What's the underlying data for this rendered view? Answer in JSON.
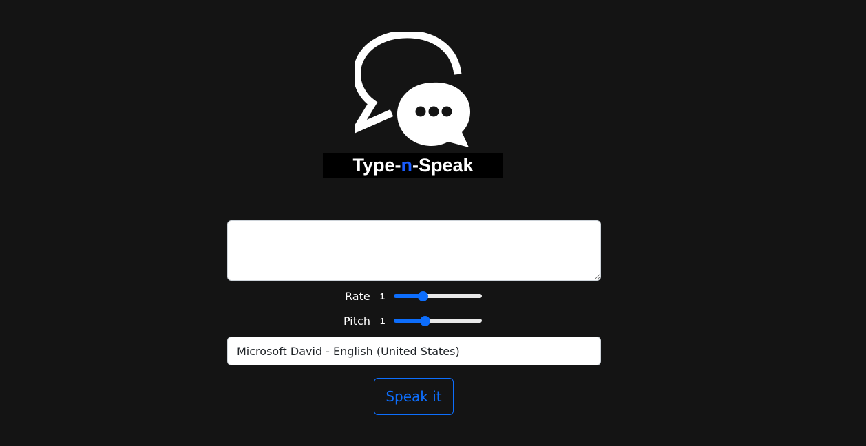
{
  "logo": {
    "text_before": "Type-",
    "text_accent": "n",
    "text_after": "-Speak",
    "icon": "chat-bubbles-icon",
    "accent_color": "#1a5cff"
  },
  "text_input": {
    "value": "",
    "placeholder": ""
  },
  "rate": {
    "label": "Rate",
    "value_display": "1",
    "value": 1,
    "min": 0.1,
    "max": 3,
    "step": 0.1
  },
  "pitch": {
    "label": "Pitch",
    "value_display": "1",
    "value": 1,
    "min": 0,
    "max": 3,
    "step": 0.1
  },
  "voice_select": {
    "selected": "Microsoft David - English (United States)"
  },
  "speak_button": {
    "label": "Speak it",
    "color": "#0d6efd"
  },
  "colors": {
    "background": "#141414",
    "primary": "#0d6efd"
  }
}
